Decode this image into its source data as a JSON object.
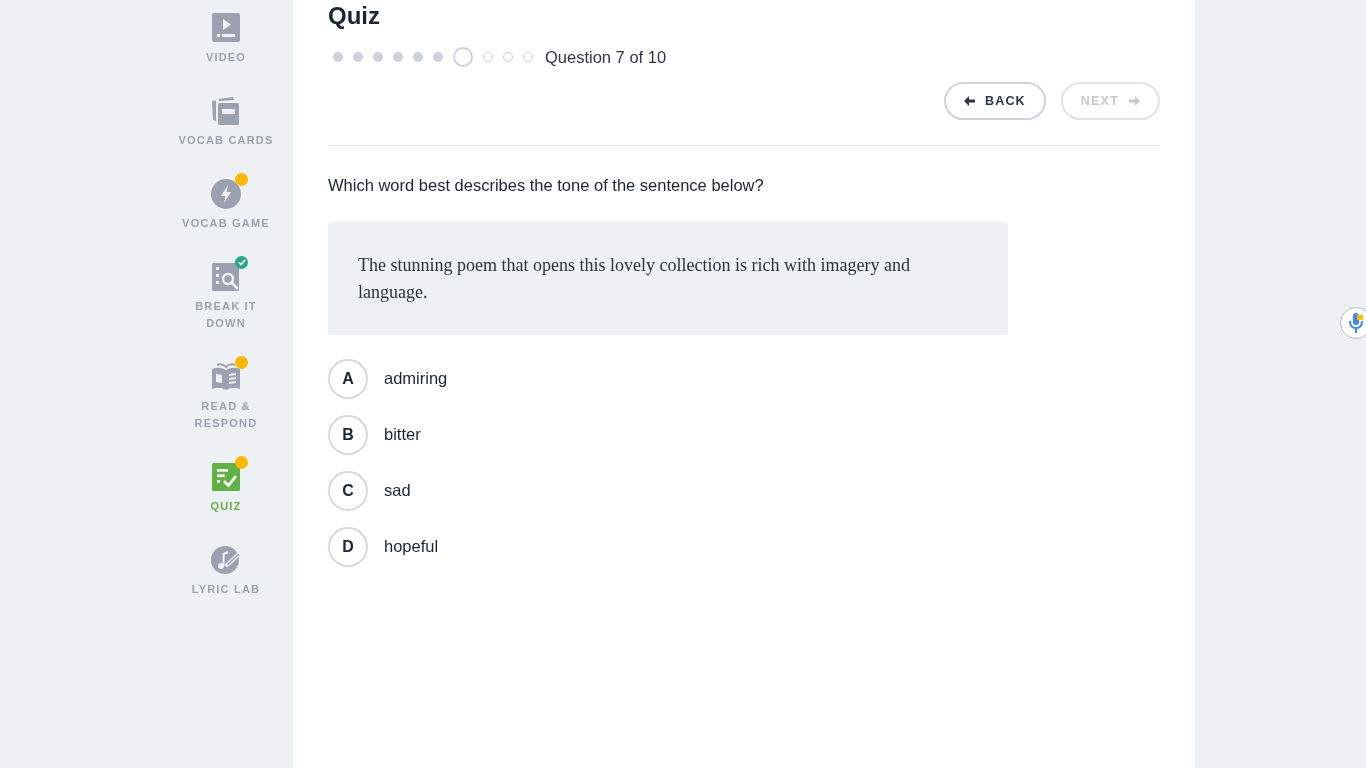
{
  "sidebar": {
    "items": [
      {
        "kind": "video",
        "label": "VIDEO",
        "selected": false,
        "notification": false,
        "completed": false
      },
      {
        "kind": "cards",
        "label": "VOCAB CARDS",
        "selected": false,
        "notification": false,
        "completed": false
      },
      {
        "kind": "game",
        "label": "VOCAB GAME",
        "selected": false,
        "notification": true,
        "completed": false
      },
      {
        "kind": "analyze",
        "label": "BREAK IT DOWN",
        "selected": false,
        "notification": false,
        "completed": true
      },
      {
        "kind": "read",
        "label": "READ & RESPOND",
        "selected": false,
        "notification": true,
        "completed": false
      },
      {
        "kind": "quiz",
        "label": "QUIZ",
        "selected": true,
        "notification": true,
        "completed": false
      },
      {
        "kind": "lyric",
        "label": "LYRIC LAB",
        "selected": false,
        "notification": false,
        "completed": false
      }
    ]
  },
  "quiz": {
    "title": "Quiz",
    "progress": {
      "steps": [
        {
          "completed": true,
          "selected": false
        },
        {
          "completed": true,
          "selected": false
        },
        {
          "completed": true,
          "selected": false
        },
        {
          "completed": true,
          "selected": false
        },
        {
          "completed": true,
          "selected": false
        },
        {
          "completed": true,
          "selected": false
        },
        {
          "completed": false,
          "selected": true
        },
        {
          "completed": false,
          "selected": false
        },
        {
          "completed": false,
          "selected": false
        },
        {
          "completed": false,
          "selected": false
        }
      ],
      "label": "Question 7 of 10"
    },
    "buttons": [
      {
        "kind": "back",
        "label": "BACK",
        "disabled": false
      },
      {
        "kind": "next",
        "label": "NEXT",
        "disabled": true
      }
    ],
    "question": "Which word best describes the tone of the sentence below?",
    "passage": "The stunning poem that opens this lovely collection is rich with imagery and language.",
    "options": [
      {
        "letter": "A",
        "text": "admiring",
        "selected": false
      },
      {
        "letter": "B",
        "text": "bitter",
        "selected": false
      },
      {
        "letter": "C",
        "text": "sad",
        "selected": false
      },
      {
        "letter": "D",
        "text": "hopeful",
        "selected": false
      }
    ]
  }
}
